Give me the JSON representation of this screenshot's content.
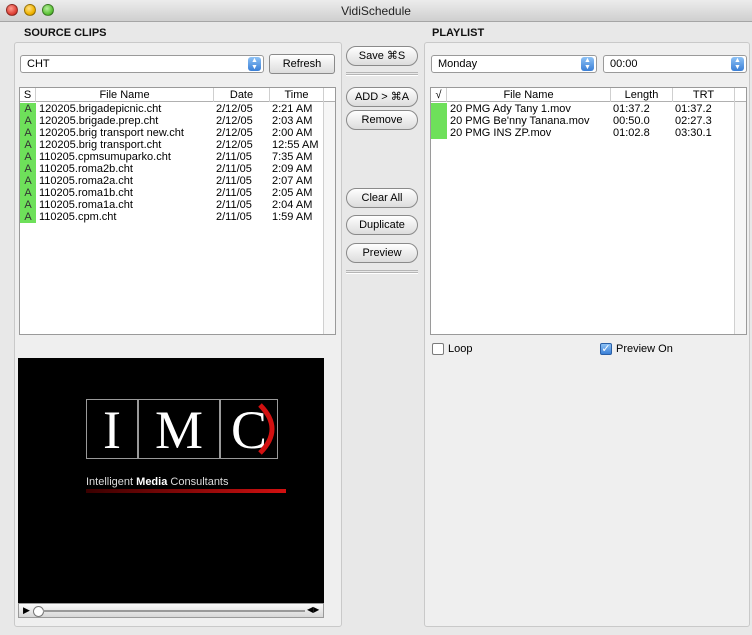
{
  "window": {
    "title": "VidiSchedule"
  },
  "source": {
    "title": "SOURCE CLIPS",
    "filter": "CHT",
    "refresh": "Refresh",
    "columns": {
      "s": "S",
      "name": "File Name",
      "date": "Date",
      "time": "Time"
    },
    "rows": [
      {
        "s": "A",
        "name": "120205.brigadepicnic.cht",
        "date": "2/12/05",
        "time": "2:21 AM"
      },
      {
        "s": "A",
        "name": "120205.brigade.prep.cht",
        "date": "2/12/05",
        "time": "2:03 AM"
      },
      {
        "s": "A",
        "name": "120205.brig transport new.cht",
        "date": "2/12/05",
        "time": "2:00 AM"
      },
      {
        "s": "A",
        "name": "120205.brig transport.cht",
        "date": "2/12/05",
        "time": "12:55 AM"
      },
      {
        "s": "A",
        "name": "110205.cpmsumuparko.cht",
        "date": "2/11/05",
        "time": "7:35 AM"
      },
      {
        "s": "A",
        "name": "110205.roma2b.cht",
        "date": "2/11/05",
        "time": "2:09 AM"
      },
      {
        "s": "A",
        "name": "110205.roma2a.cht",
        "date": "2/11/05",
        "time": "2:07 AM"
      },
      {
        "s": "A",
        "name": "110205.roma1b.cht",
        "date": "2/11/05",
        "time": "2:05 AM"
      },
      {
        "s": "A",
        "name": "110205.roma1a.cht",
        "date": "2/11/05",
        "time": "2:04 AM"
      },
      {
        "s": "A",
        "name": "110205.cpm.cht",
        "date": "2/11/05",
        "time": "1:59 AM"
      }
    ]
  },
  "middle": {
    "save": "Save ⌘S",
    "add": "ADD > ⌘A",
    "remove": "Remove",
    "clear_all": "Clear All",
    "duplicate": "Duplicate",
    "preview": "Preview"
  },
  "playlist": {
    "title": "PLAYLIST",
    "day": "Monday",
    "time": "00:00",
    "columns": {
      "check": "√",
      "name": "File Name",
      "length": "Length",
      "trt": "TRT"
    },
    "rows": [
      {
        "name": "20 PMG Ady Tany 1.mov",
        "length": "01:37.2",
        "trt": "01:37.2"
      },
      {
        "name": "20 PMG Be'nny Tanana.mov",
        "length": "00:50.0",
        "trt": "02:27.3"
      },
      {
        "name": "20 PMG INS ZP.mov",
        "length": "01:02.8",
        "trt": "03:30.1"
      }
    ],
    "loop_label": "Loop",
    "loop_checked": false,
    "preview_on_label": "Preview On",
    "preview_on_checked": true
  },
  "preview_logo": {
    "letters": [
      "I",
      "M",
      "C"
    ],
    "tag_pre": "Intelligent ",
    "tag_bold": "Media",
    "tag_post": " Consultants"
  },
  "colors": {
    "status_green": "#6ee05a",
    "accent_blue": "#3a7fd6",
    "logo_red": "#d21010"
  }
}
